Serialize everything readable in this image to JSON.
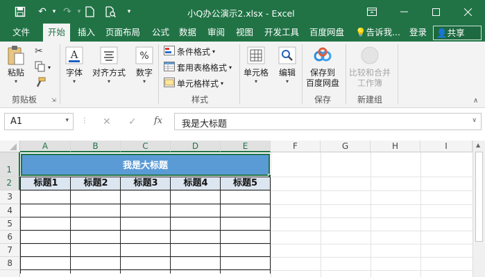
{
  "window": {
    "title": "小Q办公演示2.xlsx - Excel",
    "accent": "#217346"
  },
  "tabs": [
    {
      "label": "文件"
    },
    {
      "label": "开始"
    },
    {
      "label": "插入"
    },
    {
      "label": "页面布局"
    },
    {
      "label": "公式"
    },
    {
      "label": "数据"
    },
    {
      "label": "审阅"
    },
    {
      "label": "视图"
    },
    {
      "label": "开发工具"
    },
    {
      "label": "百度网盘"
    },
    {
      "label": "告诉我..."
    },
    {
      "label": "登录"
    },
    {
      "label": "共享"
    }
  ],
  "ribbon": {
    "paste": "粘贴",
    "clipboard_group": "剪贴板",
    "font": "字体",
    "alignment": "对齐方式",
    "number": "数字",
    "conditional_format": "条件格式",
    "table_format": "套用表格格式",
    "cell_styles": "单元格样式",
    "styles_group": "样式",
    "cells": "单元格",
    "editing": "编辑",
    "save_to_baidu_line1": "保存到",
    "save_to_baidu_line2": "百度网盘",
    "save_group": "保存",
    "compare_merge_line1": "比较和合并",
    "compare_merge_line2": "工作簿",
    "new_group": "新建组"
  },
  "formula_bar": {
    "name_box": "A1",
    "fx": "fx",
    "content": "我是大标题"
  },
  "sheet": {
    "columns": [
      "A",
      "B",
      "C",
      "D",
      "E",
      "F",
      "G",
      "H",
      "I"
    ],
    "rows": [
      "1",
      "2",
      "3",
      "4",
      "5",
      "6",
      "7",
      "8"
    ],
    "merged_title": "我是大标题",
    "headers": [
      "标题1",
      "标题2",
      "标题3",
      "标题4",
      "标题5"
    ],
    "title_fill": "#5b9bd5",
    "header_fill": "#dce6f1"
  }
}
